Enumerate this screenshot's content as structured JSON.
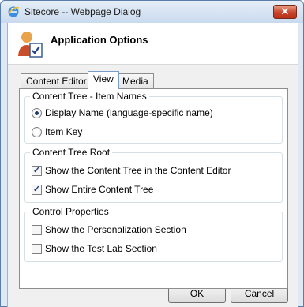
{
  "window": {
    "title": "Sitecore -- Webpage Dialog",
    "close_label": "✕"
  },
  "header": {
    "title": "Application Options",
    "icon": "user-settings-icon"
  },
  "tabs": [
    {
      "label": "Content Editor",
      "active": false
    },
    {
      "label": "View",
      "active": true
    },
    {
      "label": "Media",
      "active": false
    }
  ],
  "groups": {
    "item_names": {
      "label": "Content Tree - Item Names",
      "options": [
        {
          "label": "Display Name (language-specific name)",
          "selected": true
        },
        {
          "label": "Item Key",
          "selected": false
        }
      ]
    },
    "tree_root": {
      "label": "Content Tree Root",
      "options": [
        {
          "label": "Show the Content Tree in the Content Editor",
          "checked": true
        },
        {
          "label": "Show Entire Content Tree",
          "checked": true
        }
      ]
    },
    "control_properties": {
      "label": "Control Properties",
      "options": [
        {
          "label": "Show the Personalization Section",
          "checked": false
        },
        {
          "label": "Show the Test Lab Section",
          "checked": false
        }
      ]
    }
  },
  "buttons": {
    "ok": "OK",
    "cancel": "Cancel"
  }
}
